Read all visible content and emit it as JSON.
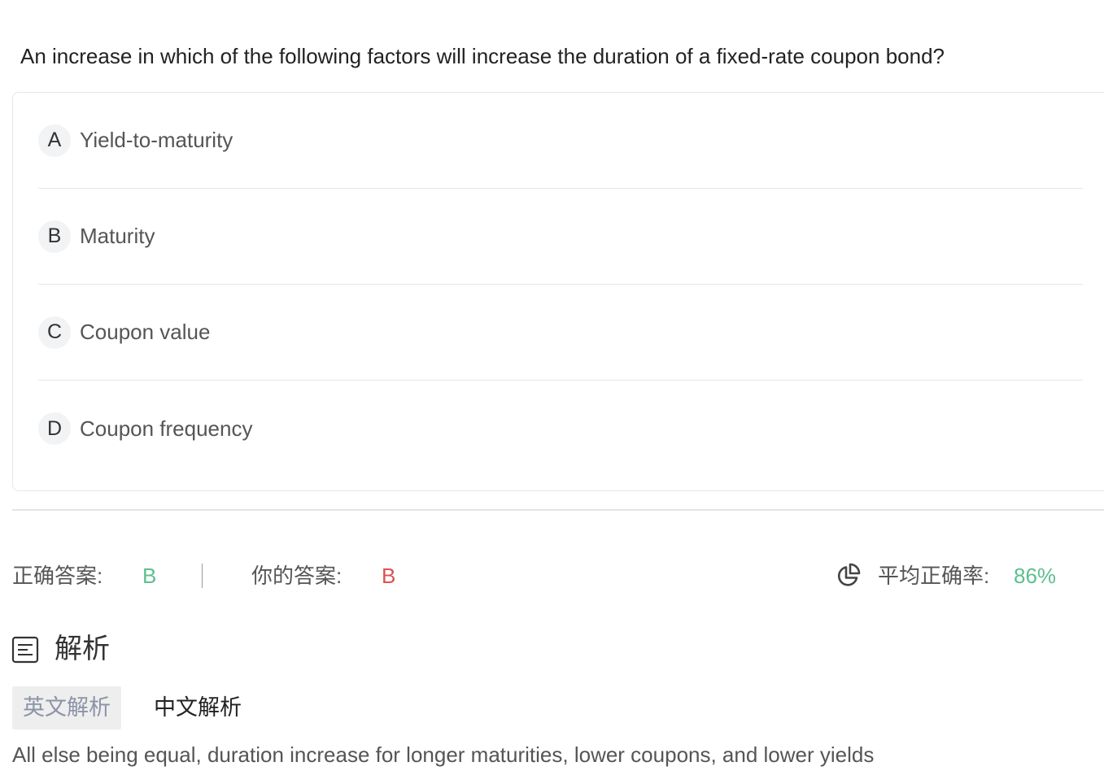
{
  "question": {
    "text": "An increase in which of the following factors will increase the duration of a fixed-rate coupon bond?"
  },
  "options": [
    {
      "letter": "A",
      "text": "Yield-to-maturity"
    },
    {
      "letter": "B",
      "text": "Maturity"
    },
    {
      "letter": "C",
      "text": "Coupon value"
    },
    {
      "letter": "D",
      "text": "Coupon frequency"
    }
  ],
  "result": {
    "correct_label": "正确答案:",
    "correct_value": "B",
    "yours_label": "你的答案:",
    "yours_value": "B",
    "avg_label": "平均正确率:",
    "avg_value": "86%",
    "stat_icon": "pie-chart-icon"
  },
  "analysis": {
    "icon": "document-lines-icon",
    "title": "解析",
    "tabs": [
      {
        "label": "英文解析",
        "active": true
      },
      {
        "label": "中文解析",
        "active": false
      }
    ],
    "text": "All else being equal, duration increase for longer maturities, lower coupons, and lower yields"
  },
  "colors": {
    "correct": "#5cc08e",
    "wrong": "#d9534f",
    "active_tab_bg": "#eeeeee",
    "active_tab_text": "#8c93a8",
    "border": "#e6e6e6"
  }
}
